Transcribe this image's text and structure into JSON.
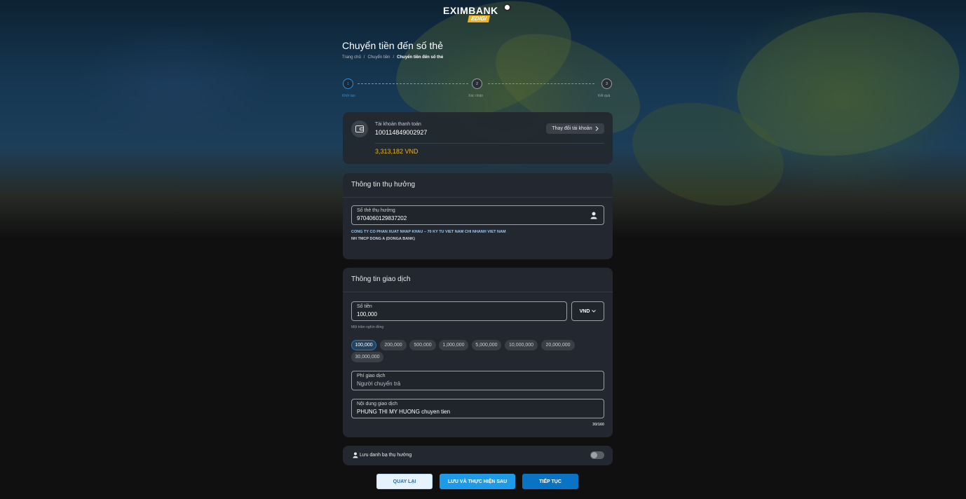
{
  "brand": {
    "name": "EXIMBANK",
    "sub": "EDIGI"
  },
  "page": {
    "title": "Chuyển tiền đến số thẻ"
  },
  "breadcrumb": {
    "home": "Trang chủ",
    "section": "Chuyển tiền",
    "current": "Chuyển tiền đến số thẻ",
    "sep": "/"
  },
  "steps": [
    {
      "num": "1",
      "label": "Khởi tạo"
    },
    {
      "num": "2",
      "label": "Xác nhận"
    },
    {
      "num": "3",
      "label": "Kết quả"
    }
  ],
  "account": {
    "label": "Tài khoản thanh toán",
    "number": "100114849002927",
    "change_label": "Thay đổi tài khoản",
    "balance": "3,313,182 VND"
  },
  "beneficiary": {
    "header": "Thông tin thụ hưởng",
    "card_label": "Số thẻ thụ hưởng",
    "card_value": "9704060129837202",
    "name": "CONG TY CO PHAN XUAT NHAP KHAU – 70 KY TU VIET NAM CHI NHANH VIET NAM",
    "bank": "NH TMCP DONG A (DONGA BANK)"
  },
  "transaction": {
    "header": "Thông tin giao dịch",
    "amount_label": "Số tiền",
    "amount_value": "100,000",
    "currency": "VND",
    "amount_words": "Một trăm nghìn đồng",
    "chips": [
      "100,000",
      "200,000",
      "500,000",
      "1,000,000",
      "5,000,000",
      "10,000,000",
      "20,000,000",
      "30,000,000"
    ],
    "fee_label": "Phí giao dịch",
    "fee_value": "Người chuyển trả",
    "content_label": "Nội dung giao dịch",
    "content_value": "PHUNG THI MY HUONG chuyen tien",
    "counter": "30/160"
  },
  "save_contact": {
    "label": "Lưu danh bạ thụ hưởng",
    "enabled": false
  },
  "buttons": {
    "back": "QUAY LẠI",
    "save_later": "LƯU VÀ THỰC HIỆN SAU",
    "next": "TIẾP TỤC"
  },
  "colors": {
    "accent": "#1e9be8",
    "balance": "#f2b21c",
    "primary_btn": "#0b73c3"
  }
}
